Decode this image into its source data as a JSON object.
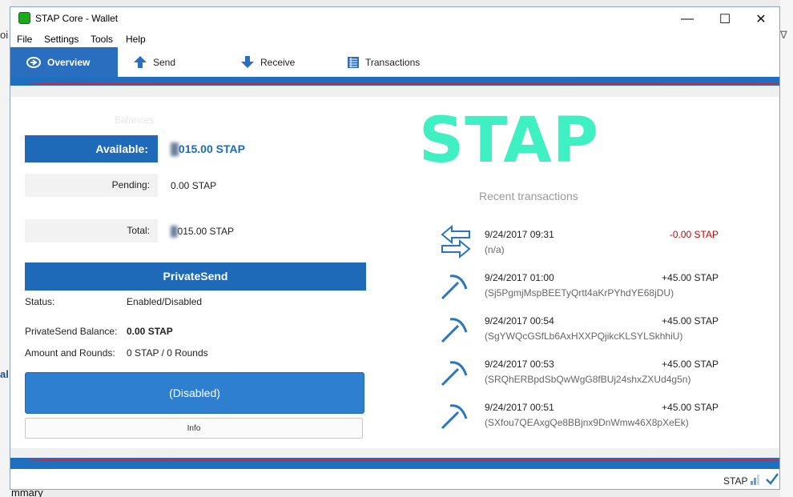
{
  "window": {
    "title": "STAP Core - Wallet"
  },
  "window_controls": {
    "minimize": "—",
    "maximize": "☐",
    "close": "✕"
  },
  "menu": [
    "File",
    "Settings",
    "Tools",
    "Help"
  ],
  "tabs": [
    {
      "label": "Overview",
      "icon": "overview-icon",
      "active": true
    },
    {
      "label": "Send",
      "icon": "send-arrow-up-icon"
    },
    {
      "label": "Receive",
      "icon": "receive-arrow-down-icon"
    },
    {
      "label": "Transactions",
      "icon": "transactions-list-icon"
    }
  ],
  "balances": {
    "heading": "Balances",
    "available_label": "Available:",
    "available_value": "015.00 STAP",
    "pending_label": "Pending:",
    "pending_value": "0.00 STAP",
    "total_label": "Total:",
    "total_value": "015.00 STAP"
  },
  "privatesend": {
    "heading": "PrivateSend",
    "status_label": "Status:",
    "status_value": "Enabled/Disabled",
    "balance_label": "PrivateSend Balance:",
    "balance_value": "0.00 STAP",
    "rounds_label": "Amount and Rounds:",
    "rounds_value": "0 STAP / 0 Rounds",
    "toggle_button": "(Disabled)",
    "info_button": "Info"
  },
  "logo": {
    "text": "STAP",
    "color": "#3ef0c2"
  },
  "recent": {
    "heading": "Recent transactions",
    "items": [
      {
        "date": "9/24/2017 09:31",
        "amount": "-0.00 STAP",
        "address": "(n/a)",
        "icon": "payment-to-yourself-icon",
        "negative": true
      },
      {
        "date": "9/24/2017 01:00",
        "amount": "+45.00 STAP",
        "address": "(Sj5PgmjMspBEETyQrtt4aKrPYhdYE68jDU)",
        "icon": "mined-pickaxe-icon"
      },
      {
        "date": "9/24/2017 00:54",
        "amount": "+45.00 STAP",
        "address": "(SgYWQcGSfLb6AxHXXPQjikcKLSYLSkhhiU)",
        "icon": "mined-pickaxe-icon"
      },
      {
        "date": "9/24/2017 00:53",
        "amount": "+45.00 STAP",
        "address": "(SRQhERBpdSbQwWgG8fBUj24shxZXUd4g5n)",
        "icon": "mined-pickaxe-icon"
      },
      {
        "date": "9/24/2017 00:51",
        "amount": "+45.00 STAP",
        "address": "(SXfou7QEAxgQe8BBjnx9DnWmw46X8pXeEk)",
        "icon": "mined-pickaxe-icon"
      }
    ]
  },
  "statusbar": {
    "unit": "STAP"
  },
  "background": {
    "left_top": "oi",
    "left_mid": "al",
    "bottom": "mmary"
  },
  "colors": {
    "accent": "#1f6ab8",
    "negative": "#cc0000",
    "band_red": "#d9232e",
    "tx_icon": "#2a75c0"
  }
}
